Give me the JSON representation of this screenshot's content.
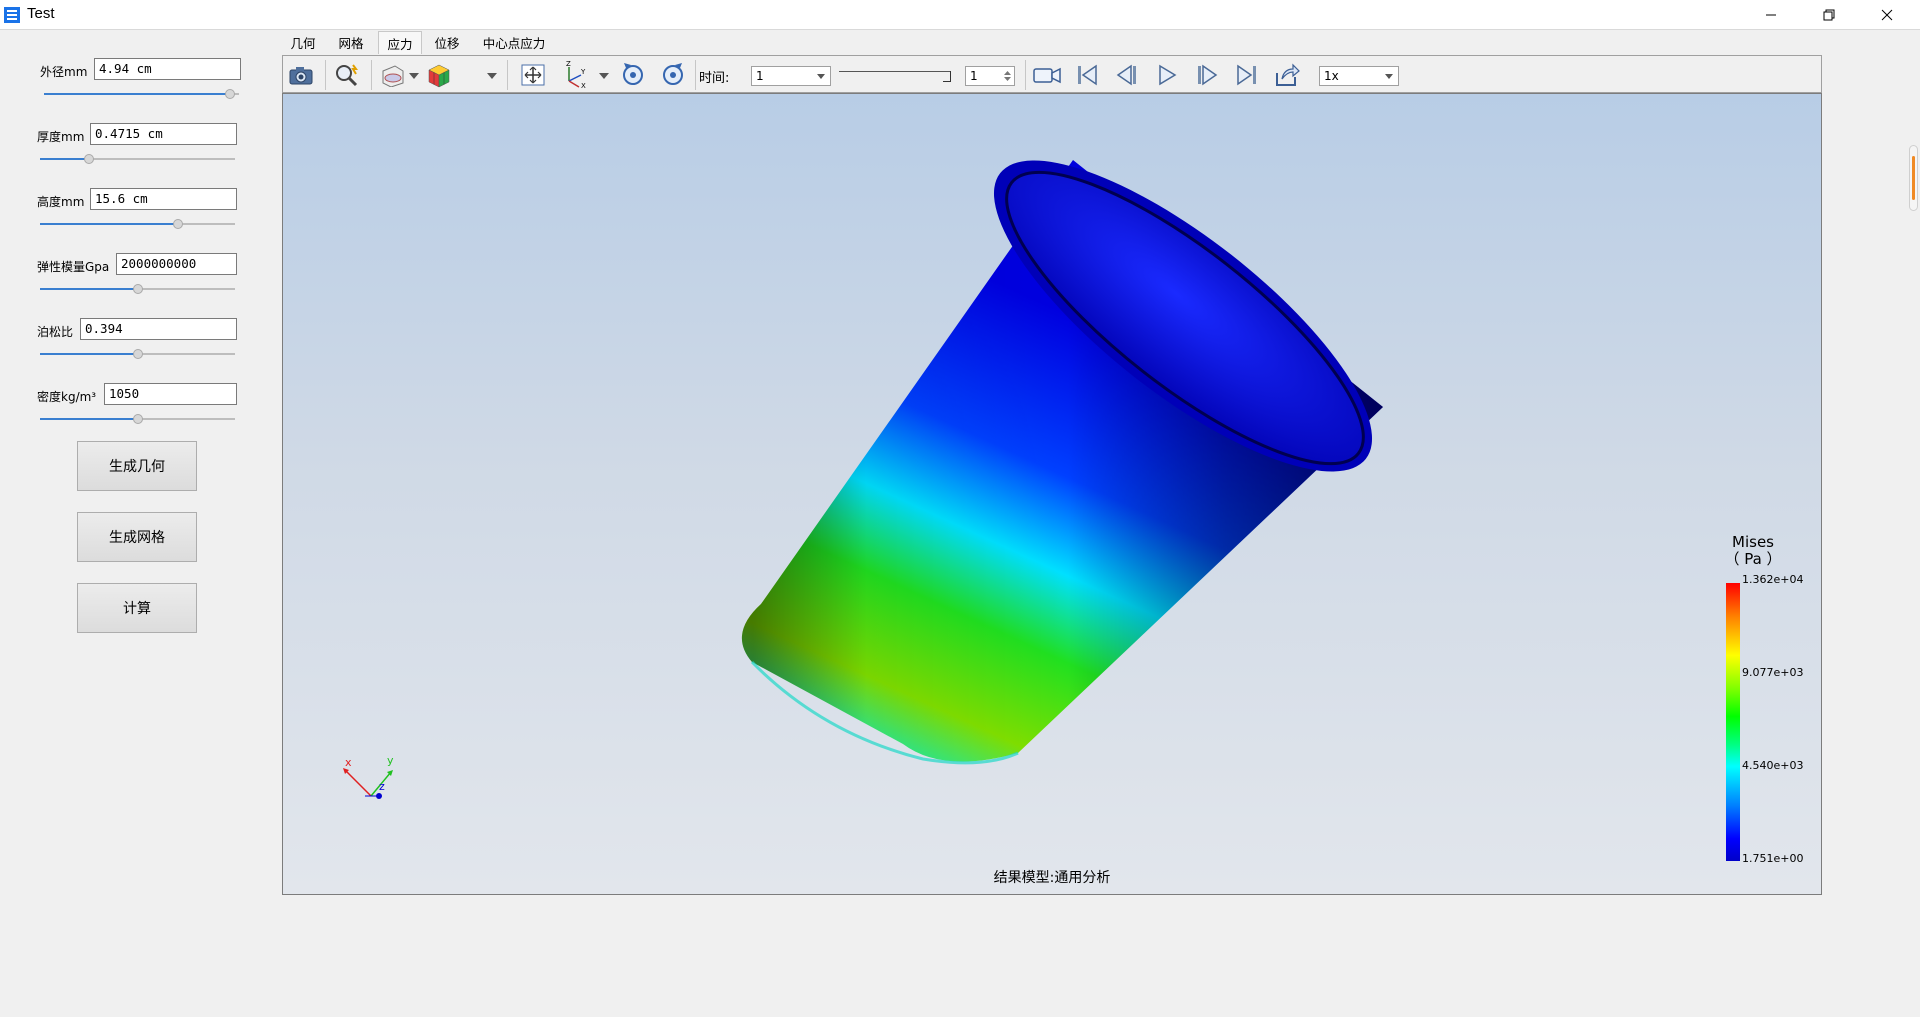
{
  "window": {
    "title": "Test"
  },
  "params": [
    {
      "label": "外径mm",
      "value": "4.94 cm",
      "slider": 0.98
    },
    {
      "label": "厚度mm",
      "value": "0.4715 cm",
      "slider": 0.24
    },
    {
      "label": "高度mm",
      "value": "15.6 cm",
      "slider": 0.72
    },
    {
      "label": "弹性模量Gpa",
      "value": "2000000000",
      "slider": 0.5
    },
    {
      "label": "泊松比",
      "value": "0.394",
      "slider": 0.5
    },
    {
      "label": "密度kg/m³",
      "value": "1050",
      "slider": 0.5
    }
  ],
  "buttons": {
    "geometry": "生成几何",
    "mesh": "生成网格",
    "compute": "计算"
  },
  "tabs": [
    "几何",
    "网格",
    "应力",
    "位移",
    "中心点应力"
  ],
  "active_tab": "应力",
  "toolbar": {
    "time_label": "时间:",
    "time_value": "1",
    "frame_value": "1",
    "speed_value": "1x"
  },
  "viewport": {
    "legend_title": "Mises\n（ Pa ）",
    "legend_labels": [
      "1.362e+04",
      "9.077e+03",
      "4.540e+03",
      "1.751e+00"
    ],
    "axes": {
      "x": "x",
      "y": "y",
      "z": "z"
    },
    "caption": "结果模型:通用分析"
  },
  "colors": {
    "accent": "#3a7fd0",
    "bg": "#f0f0f0"
  }
}
